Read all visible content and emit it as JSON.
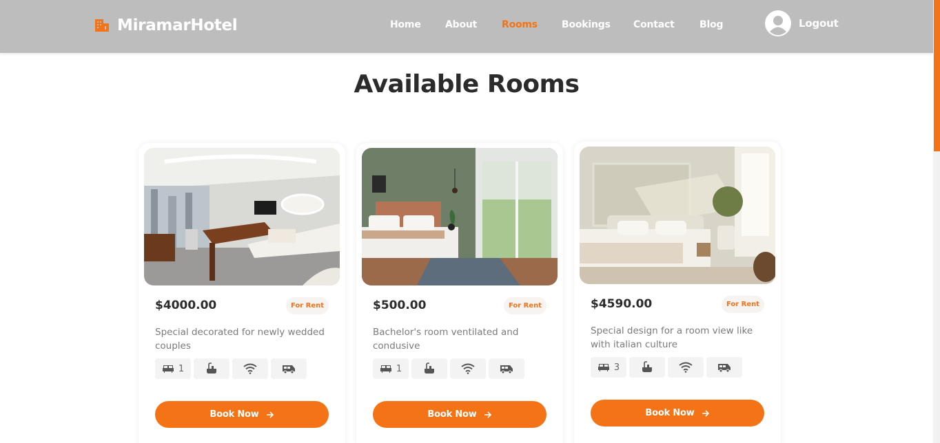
{
  "header": {
    "brand": "MiramarHotel",
    "nav": [
      {
        "label": "Home",
        "active": false
      },
      {
        "label": "About",
        "active": false
      },
      {
        "label": "Rooms",
        "active": true
      },
      {
        "label": "Bookings",
        "active": false
      },
      {
        "label": "Contact",
        "active": false
      },
      {
        "label": "Blog",
        "active": false
      }
    ],
    "logout_label": "Logout"
  },
  "colors": {
    "accent": "#f37316",
    "header_bg": "#bdbdbd"
  },
  "page_title": "Available Rooms",
  "rooms": [
    {
      "price": "$4000.00",
      "badge": "For Rent",
      "description": "Special decorated for newly wedded couples",
      "beds": "1",
      "button_label": "Book Now"
    },
    {
      "price": "$500.00",
      "badge": "For Rent",
      "description": "Bachelor's room ventilated and condusive",
      "beds": "1",
      "button_label": "Book Now"
    },
    {
      "price": "$4590.00",
      "badge": "For Rent",
      "description": "Special design for a room view like with italian culture",
      "beds": "3",
      "button_label": "Book Now"
    }
  ],
  "amenity_icons": [
    "bed-icon",
    "bathtub-icon",
    "wifi-icon",
    "shuttle-bus-icon"
  ]
}
